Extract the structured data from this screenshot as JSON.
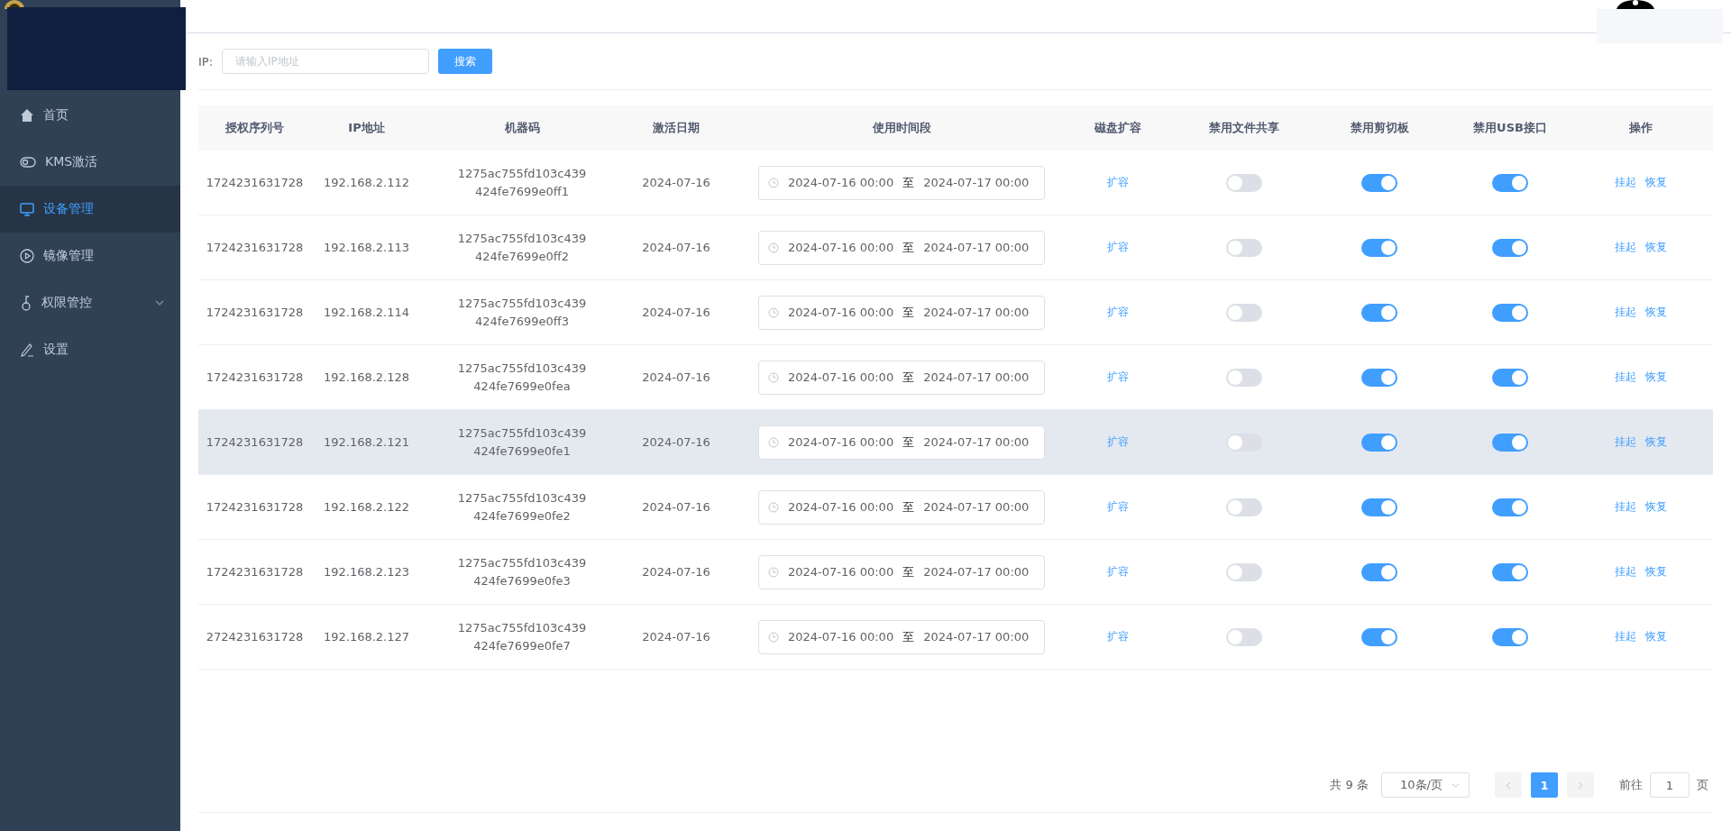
{
  "sidebar": {
    "items": [
      {
        "label": "首页",
        "selected": false
      },
      {
        "label": "KMS激活",
        "selected": false
      },
      {
        "label": "设备管理",
        "selected": true
      },
      {
        "label": "镜像管理",
        "selected": false
      },
      {
        "label": "权限管控",
        "selected": false,
        "expandable": true
      },
      {
        "label": "设置",
        "selected": false
      }
    ]
  },
  "search": {
    "label": "IP:",
    "placeholder": "请输入IP地址",
    "button": "搜索"
  },
  "table": {
    "columns": [
      "授权序列号",
      "IP地址",
      "机器码",
      "激活日期",
      "使用时间段",
      "磁盘扩容",
      "禁用文件共享",
      "禁用剪切板",
      "禁用USB接口",
      "操作"
    ],
    "rows": [
      {
        "serial": "1724231631728",
        "ip": "192.168.2.112",
        "machine": [
          "1275ac755fd103c439",
          "424fe7699e0ff1"
        ],
        "date": "2024-07-16",
        "start": "2024-07-16 00:00",
        "sep": "至",
        "end": "2024-07-17 00:00",
        "expand": "扩容",
        "share_off": false,
        "clip_off": true,
        "usb_off": true,
        "actions": [
          "挂起",
          "恢复"
        ],
        "highlighted": false
      },
      {
        "serial": "1724231631728",
        "ip": "192.168.2.113",
        "machine": [
          "1275ac755fd103c439",
          "424fe7699e0ff2"
        ],
        "date": "2024-07-16",
        "start": "2024-07-16 00:00",
        "sep": "至",
        "end": "2024-07-17 00:00",
        "expand": "扩容",
        "share_off": false,
        "clip_off": true,
        "usb_off": true,
        "actions": [
          "挂起",
          "恢复"
        ],
        "highlighted": false
      },
      {
        "serial": "1724231631728",
        "ip": "192.168.2.114",
        "machine": [
          "1275ac755fd103c439",
          "424fe7699e0ff3"
        ],
        "date": "2024-07-16",
        "start": "2024-07-16 00:00",
        "sep": "至",
        "end": "2024-07-17 00:00",
        "expand": "扩容",
        "share_off": false,
        "clip_off": true,
        "usb_off": true,
        "actions": [
          "挂起",
          "恢复"
        ],
        "highlighted": false
      },
      {
        "serial": "1724231631728",
        "ip": "192.168.2.128",
        "machine": [
          "1275ac755fd103c439",
          "424fe7699e0fea"
        ],
        "date": "2024-07-16",
        "start": "2024-07-16 00:00",
        "sep": "至",
        "end": "2024-07-17 00:00",
        "expand": "扩容",
        "share_off": false,
        "clip_off": true,
        "usb_off": true,
        "actions": [
          "挂起",
          "恢复"
        ],
        "highlighted": false
      },
      {
        "serial": "1724231631728",
        "ip": "192.168.2.121",
        "machine": [
          "1275ac755fd103c439",
          "424fe7699e0fe1"
        ],
        "date": "2024-07-16",
        "start": "2024-07-16 00:00",
        "sep": "至",
        "end": "2024-07-17 00:00",
        "expand": "扩容",
        "share_off": false,
        "clip_off": true,
        "usb_off": true,
        "actions": [
          "挂起",
          "恢复"
        ],
        "highlighted": true
      },
      {
        "serial": "1724231631728",
        "ip": "192.168.2.122",
        "machine": [
          "1275ac755fd103c439",
          "424fe7699e0fe2"
        ],
        "date": "2024-07-16",
        "start": "2024-07-16 00:00",
        "sep": "至",
        "end": "2024-07-17 00:00",
        "expand": "扩容",
        "share_off": false,
        "clip_off": true,
        "usb_off": true,
        "actions": [
          "挂起",
          "恢复"
        ],
        "highlighted": false
      },
      {
        "serial": "1724231631728",
        "ip": "192.168.2.123",
        "machine": [
          "1275ac755fd103c439",
          "424fe7699e0fe3"
        ],
        "date": "2024-07-16",
        "start": "2024-07-16 00:00",
        "sep": "至",
        "end": "2024-07-17 00:00",
        "expand": "扩容",
        "share_off": false,
        "clip_off": true,
        "usb_off": true,
        "actions": [
          "挂起",
          "恢复"
        ],
        "highlighted": false
      },
      {
        "serial": "2724231631728",
        "ip": "192.168.2.127",
        "machine": [
          "1275ac755fd103c439",
          "424fe7699e0fe7"
        ],
        "date": "2024-07-16",
        "start": "2024-07-16 00:00",
        "sep": "至",
        "end": "2024-07-17 00:00",
        "expand": "扩容",
        "share_off": false,
        "clip_off": true,
        "usb_off": true,
        "actions": [
          "挂起",
          "恢复"
        ],
        "highlighted": false
      }
    ]
  },
  "pagination": {
    "total": "共 9 条",
    "page_size": "10条/页",
    "pages": [
      {
        "label": "1",
        "selected": true
      }
    ],
    "goto_label": "前往",
    "goto_value": "1",
    "goto_suffix": "页"
  }
}
